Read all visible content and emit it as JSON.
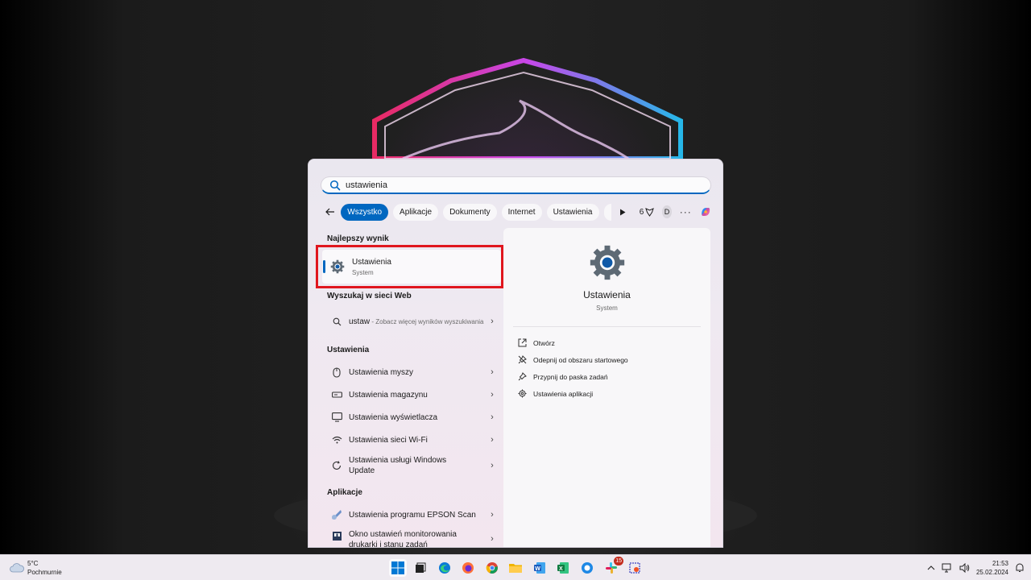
{
  "search": {
    "query": "ustawienia"
  },
  "filters": [
    {
      "label": "Wszystko",
      "active": true
    },
    {
      "label": "Aplikacje",
      "active": false
    },
    {
      "label": "Dokumenty",
      "active": false
    },
    {
      "label": "Internet",
      "active": false
    },
    {
      "label": "Ustawienia",
      "active": false
    }
  ],
  "header_extras": {
    "points": "6",
    "avatar": "D",
    "more": "···"
  },
  "sections": {
    "best": "Najlepszy wynik",
    "web": "Wyszukaj w sieci Web",
    "settings": "Ustawienia",
    "apps": "Aplikacje"
  },
  "best_result": {
    "title": "Ustawienia",
    "subtitle": "System"
  },
  "web_result": {
    "term": "ustaw",
    "hint": " - Zobacz więcej wyników wyszukiwania"
  },
  "settings_results": [
    {
      "label": "Ustawienia myszy",
      "icon": "mouse-icon"
    },
    {
      "label": "Ustawienia magazynu",
      "icon": "storage-icon"
    },
    {
      "label": "Ustawienia wyświetlacza",
      "icon": "display-icon"
    },
    {
      "label": "Ustawienia sieci Wi-Fi",
      "icon": "wifi-icon"
    },
    {
      "label": "Ustawienia usługi Windows Update",
      "icon": "update-icon"
    }
  ],
  "app_results": [
    {
      "label": "Ustawienia programu EPSON Scan",
      "icon": "epson-icon"
    },
    {
      "label": "Okno ustawień monitorowania drukarki i stanu zadań",
      "icon": "printer-icon"
    }
  ],
  "preview": {
    "title": "Ustawienia",
    "subtitle": "System",
    "actions": [
      {
        "label": "Otwórz",
        "icon": "open-icon"
      },
      {
        "label": "Odepnij od obszaru startowego",
        "icon": "unpin-icon"
      },
      {
        "label": "Przypnij do paska zadań",
        "icon": "pin-icon"
      },
      {
        "label": "Ustawienia aplikacji",
        "icon": "gear-icon"
      }
    ]
  },
  "taskbar": {
    "weather_temp": "5°C",
    "weather_desc": "Pochmurnie",
    "mail_badge": "15",
    "time": "21:53",
    "date": "25.02.2024"
  },
  "colors": {
    "accent": "#0067c0",
    "highlight": "#e0161e"
  }
}
